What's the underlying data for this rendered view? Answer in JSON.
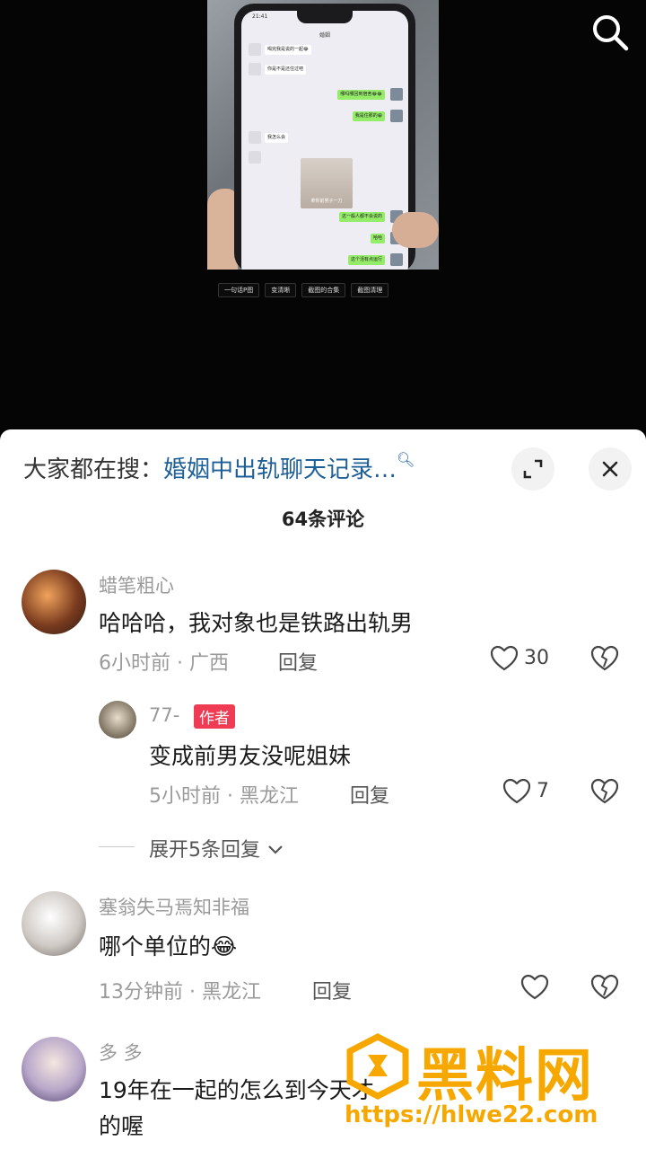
{
  "video": {
    "phone_time": "21:41",
    "chat_title": "婚姻",
    "messages": [
      {
        "side": "in",
        "text": "喝完我是说的一起😂"
      },
      {
        "side": "in",
        "text": "你是不是还住过吧"
      },
      {
        "side": "out",
        "text": "哪吗哪回到宿舍😂😂"
      },
      {
        "side": "out",
        "text": "我是住那的😁"
      },
      {
        "side": "in",
        "text": "我怎么会"
      },
      {
        "side": "out",
        "text": "这一般人都不会说的"
      },
      {
        "side": "out",
        "text": "哈哈"
      },
      {
        "side": "out",
        "text": "这个活有点运行"
      }
    ],
    "image_caption": "拿你前男子一刀",
    "tags": [
      "一句话P图",
      "变清晰",
      "截图的合集",
      "截图清理"
    ]
  },
  "hot_search": {
    "label": "大家都在搜：",
    "term": "婚姻中出轨聊天记录…",
    "icon": "search-icon"
  },
  "comment_count": "64条评论",
  "comments": [
    {
      "name": "蜡笔粗心",
      "text": "哈哈哈，我对象也是铁路出轨男",
      "time": "6小时前",
      "location": "广西",
      "reply_label": "回复",
      "likes": "30"
    },
    {
      "name": "77-",
      "badge": "作者",
      "text": "变成前男友没呢姐妹",
      "time": "5小时前",
      "location": "黑龙江",
      "reply_label": "回复",
      "likes": "7"
    },
    {
      "name": "塞翁失马焉知非福",
      "text": "哪个单位的😂",
      "time": "13分钟前",
      "location": "黑龙江",
      "reply_label": "回复",
      "likes": ""
    },
    {
      "name": "多 多",
      "text_line1": "19年在一起的怎么到今天才",
      "text_line2": "的喔"
    }
  ],
  "expand_replies": "展开5条回复",
  "watermark": {
    "title": "黑料网",
    "url": "https://hlwe22.com"
  },
  "colors": {
    "accent_red": "#ef3b53",
    "link_blue": "#1e5f98",
    "watermark_orange": "#f7a800"
  }
}
